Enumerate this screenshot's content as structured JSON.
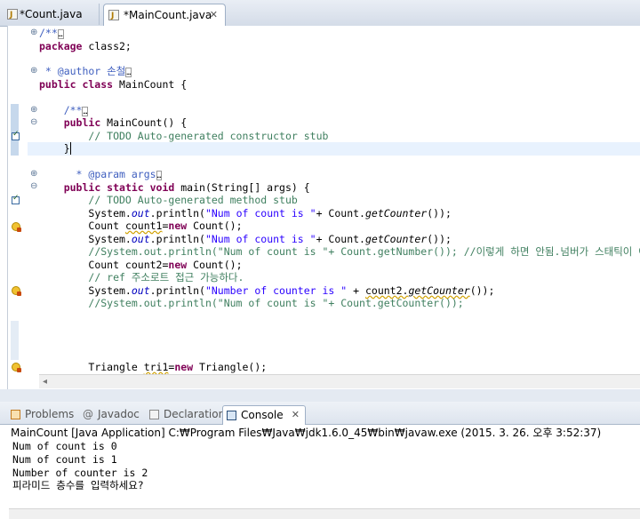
{
  "editor_tabs": [
    {
      "label": "*Count.java",
      "active": false
    },
    {
      "label": "*MainCount.java",
      "active": true
    }
  ],
  "code": {
    "l1": "/**",
    "l2a": "package",
    "l2b": " class2;",
    "l3": " * @author 손철",
    "l4a": "public class",
    "l4b": " MainCount {",
    "l5": "/**",
    "l6a": "public",
    "l6b": " MainCount() {",
    "l7": "// TODO Auto-generated constructor stub",
    "l8": "}",
    "l9": " * @param args",
    "l10a": "public static void",
    "l10b": " main(String[] args) {",
    "l11": "// TODO Auto-generated method stub",
    "l12a": "System.",
    "l12b": "out",
    "l12c": ".println(",
    "l12d": "\"Num of count is \"",
    "l12e": "+ Count.",
    "l12f": "getCounter",
    "l12g": "());",
    "l13a": "Count ",
    "l13b": "count1",
    "l13c": "=",
    "l13d": "new",
    "l13e": " Count();",
    "l14a": "System.",
    "l14b": "out",
    "l14c": ".println(",
    "l14d": "\"Num of count is \"",
    "l14e": "+ Count.",
    "l14f": "getCounter",
    "l14g": "());",
    "l15": "//System.out.println(\"Num of count is \"+ Count.getNumber()); //이렇게 하면 안됨.넘버가 스태틱이 아님",
    "l16a": "Count count2=",
    "l16b": "new",
    "l16c": " Count();",
    "l17": "// ref 주소로트 접근 가능하다.",
    "l18a": "System.",
    "l18b": "out",
    "l18c": ".println(",
    "l18d": "\"Number of counter is \"",
    "l18e": " + ",
    "l18f": "count2.",
    "l18g": "getCounter",
    "l18h": "());",
    "l19": "//System.out.println(\"Num of count is \"+ Count.getCounter());",
    "l20a": "Triangle ",
    "l20b": "tri1",
    "l20c": "=",
    "l20d": "new",
    "l20e": " Triangle();"
  },
  "panel_tabs": {
    "problems": "Problems",
    "javadoc": "Javadoc",
    "declaration": "Declaration",
    "console": "Console"
  },
  "console": {
    "title": "MainCount [Java Application] C:₩Program Files₩Java₩jdk1.6.0_45₩bin₩javaw.exe (2015. 3. 26. 오후 3:52:37)",
    "lines": [
      "Num of count is 0",
      "Num of count is 1",
      "Number of counter is 2",
      "피라미드 층수를 입력하세요?"
    ]
  },
  "colors": {
    "keyword": "#7f0055",
    "comment": "#3f7f5f",
    "javadoc": "#3f5fbf",
    "string": "#2a00ff",
    "field": "#0000c0",
    "current_line": "#e8f2fe"
  }
}
